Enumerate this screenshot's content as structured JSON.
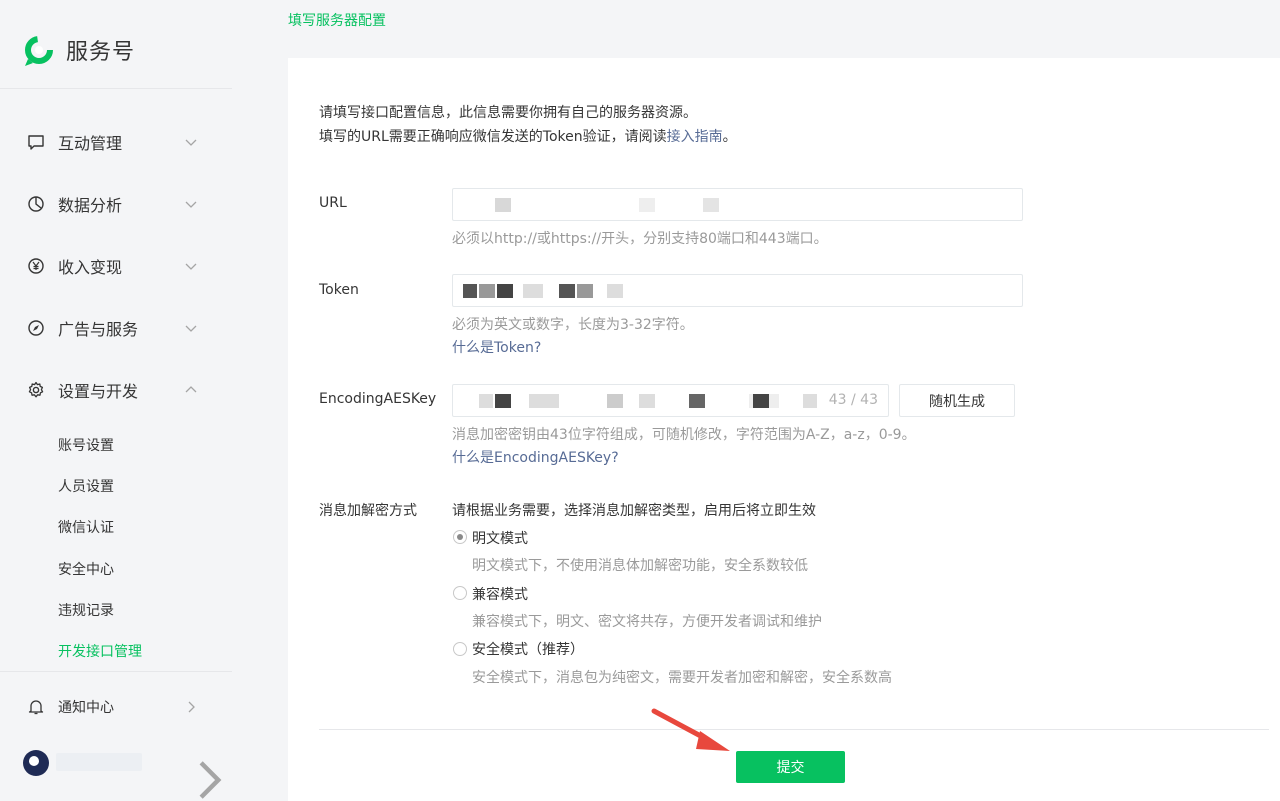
{
  "brand": {
    "name": "服务号",
    "logo_icon": "wechat-service-logo-icon",
    "color": "#07c160"
  },
  "sidebar": {
    "nav": [
      {
        "label": "互动管理",
        "icon": "message-icon",
        "chevron": "down"
      },
      {
        "label": "数据分析",
        "icon": "pie-chart-icon",
        "chevron": "down"
      },
      {
        "label": "收入变现",
        "icon": "yen-icon",
        "chevron": "down"
      },
      {
        "label": "广告与服务",
        "icon": "compass-icon",
        "chevron": "down"
      },
      {
        "label": "设置与开发",
        "icon": "gear-icon",
        "chevron": "up"
      }
    ],
    "sub_items": [
      {
        "label": "账号设置"
      },
      {
        "label": "人员设置"
      },
      {
        "label": "微信认证"
      },
      {
        "label": "安全中心"
      },
      {
        "label": "违规记录"
      },
      {
        "label": "开发接口管理",
        "active": true
      }
    ],
    "notify": {
      "label": "通知中心",
      "icon": "bell-icon"
    }
  },
  "breadcrumb": "填写服务器配置",
  "intro": {
    "line1": "请填写接口配置信息，此信息需要你拥有自己的服务器资源。",
    "line2_prefix": "填写的URL需要正确响应微信发送的Token验证，请阅读",
    "line2_link": "接入指南",
    "line2_suffix": "。"
  },
  "form": {
    "url": {
      "label": "URL",
      "hint": "必须以http://或https://开头，分别支持80端口和443端口。"
    },
    "token": {
      "label": "Token",
      "hint": "必须为英文或数字，长度为3-32字符。",
      "link": "什么是Token?"
    },
    "aeskey": {
      "label": "EncodingAESKey",
      "counter": "43 / 43",
      "generate_label": "随机生成",
      "hint": "消息加密密钥由43位字符组成，可随机修改，字符范围为A-Z，a-z，0-9。",
      "link": "什么是EncodingAESKey?"
    },
    "encrypt": {
      "label": "消息加解密方式",
      "intro": "请根据业务需要，选择消息加解密类型，启用后将立即生效",
      "options": [
        {
          "label": "明文模式",
          "desc": "明文模式下，不使用消息体加解密功能，安全系数较低",
          "checked": true
        },
        {
          "label": "兼容模式",
          "desc": "兼容模式下，明文、密文将共存，方便开发者调试和维护",
          "checked": false
        },
        {
          "label": "安全模式（推荐）",
          "desc": "安全模式下，消息包为纯密文，需要开发者加密和解密，安全系数高",
          "checked": false
        }
      ]
    }
  },
  "submit_label": "提交",
  "annotation_arrow_color": "#e8483d"
}
